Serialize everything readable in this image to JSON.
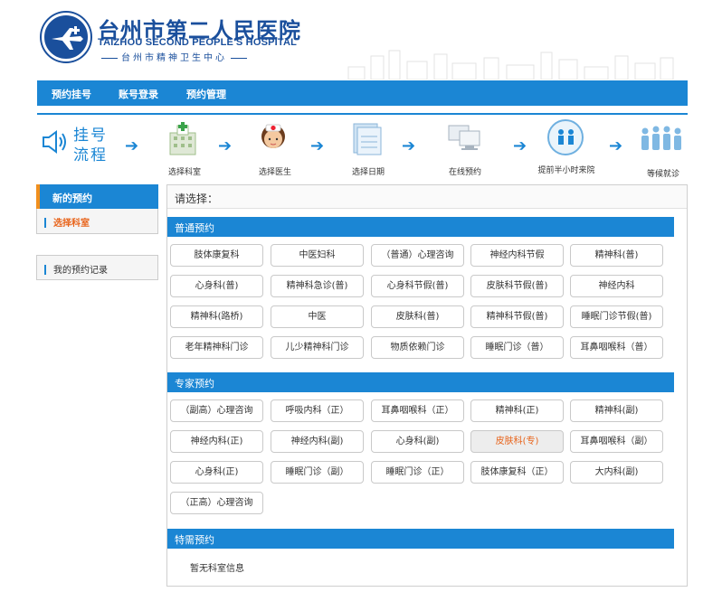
{
  "header": {
    "hospital_cn": "台州市第二人民医院",
    "hospital_en": "TAIZHOU SECOND PEOPLE'S HOSPITAL",
    "hospital_sub": "台州市精神卫生中心"
  },
  "nav": [
    "预约挂号",
    "账号登录",
    "预约管理"
  ],
  "process": {
    "title_line1": "挂号",
    "title_line2": "流程",
    "steps": [
      "选择科室",
      "选择医生",
      "选择日期",
      "在线预约",
      "提前半小时来院",
      "等候就诊"
    ]
  },
  "sidebar": {
    "header": "新的预约",
    "selected": "选择科室",
    "records": "我的预约记录"
  },
  "main": {
    "prompt": "请选择：",
    "sections": [
      {
        "title": "普通预约",
        "items": [
          "肢体康复科",
          "中医妇科",
          "（普通）心理咨询",
          "神经内科节假",
          "精神科(普)",
          "心身科(普)",
          "精神科急诊(普)",
          "心身科节假(普)",
          "皮肤科节假(普)",
          "神经内科",
          "精神科(路桥)",
          "中医",
          "皮肤科(普)",
          "精神科节假(普)",
          "睡眠门诊节假(普)",
          "老年精神科门诊",
          "儿少精神科门诊",
          "物质依赖门诊",
          "睡眠门诊（普）",
          "耳鼻咽喉科（普）"
        ]
      },
      {
        "title": "专家预约",
        "items": [
          "（副高）心理咨询",
          "呼吸内科（正）",
          "耳鼻咽喉科（正）",
          "精神科(正)",
          "精神科(副)",
          "神经内科(正)",
          "神经内科(副)",
          "心身科(副)",
          "皮肤科(专)",
          "耳鼻咽喉科（副）",
          "心身科(正)",
          "睡眠门诊（副）",
          "睡眠门诊（正）",
          "肢体康复科（正）",
          "大内科(副)",
          "（正高）心理咨询"
        ],
        "active": "皮肤科(专)"
      },
      {
        "title": "特需预约",
        "empty": "暂无科室信息"
      }
    ]
  },
  "colors": {
    "primary": "#1b86d4",
    "accent": "#e8641b",
    "logo": "#1a4f9c"
  }
}
